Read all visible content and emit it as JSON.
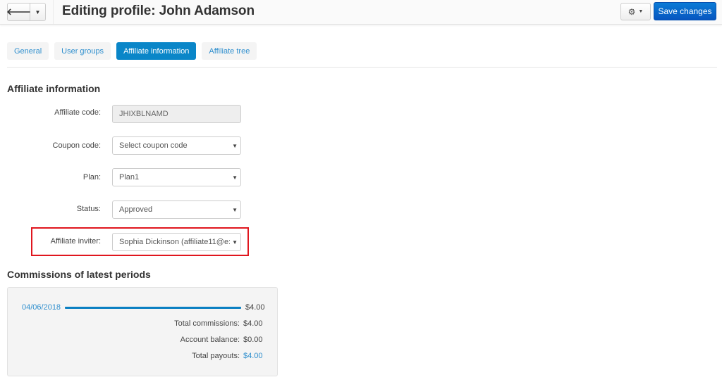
{
  "header": {
    "title": "Editing profile: John Adamson",
    "back_icon": "arrow-left-icon",
    "caret_icon": "caret-down-icon",
    "settings_icon": "gear-icon",
    "save_label": "Save changes"
  },
  "tabs": [
    {
      "label": "General",
      "active": false
    },
    {
      "label": "User groups",
      "active": false
    },
    {
      "label": "Affiliate information",
      "active": true
    },
    {
      "label": "Affiliate tree",
      "active": false
    }
  ],
  "affiliate_info": {
    "title": "Affiliate information",
    "fields": [
      {
        "label": "Affiliate code:",
        "value": "JHIXBLNAMD",
        "type": "readonly"
      },
      {
        "label": "Coupon code:",
        "value": "Select coupon code",
        "type": "select"
      },
      {
        "label": "Plan:",
        "value": "Plan1",
        "type": "select"
      },
      {
        "label": "Status:",
        "value": "Approved",
        "type": "select"
      },
      {
        "label": "Affiliate inviter:",
        "value": "Sophia Dickinson (affiliate11@e:",
        "type": "select",
        "highlighted": true
      }
    ]
  },
  "commissions": {
    "title": "Commissions of latest periods",
    "periods": [
      {
        "date": "04/06/2018",
        "amount": "$4.00",
        "bar_fraction": 1.0
      }
    ],
    "summary": [
      {
        "label": "Total commissions:",
        "value": "$4.00",
        "link": false
      },
      {
        "label": "Account balance:",
        "value": "$0.00",
        "link": false
      },
      {
        "label": "Total payouts:",
        "value": "$4.00",
        "link": true
      }
    ]
  },
  "colors": {
    "accent": "#0a86c8",
    "link": "#2f8fce",
    "primary_button": "#0756c0",
    "highlight": "#e0161e"
  }
}
